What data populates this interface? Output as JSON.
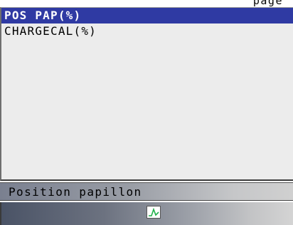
{
  "header": {
    "partial_text": "page"
  },
  "pid_list": {
    "items": [
      {
        "label": "POS PAP(%)",
        "selected": true
      },
      {
        "label": "CHARGECAL(%)",
        "selected": false
      }
    ]
  },
  "description": {
    "text": "Position papillon"
  },
  "toolbar": {
    "graph_icon": "graph-icon"
  },
  "colors": {
    "selection": "#2f3aa3",
    "panel": "#ececec",
    "graph_line": "#22b14c"
  }
}
